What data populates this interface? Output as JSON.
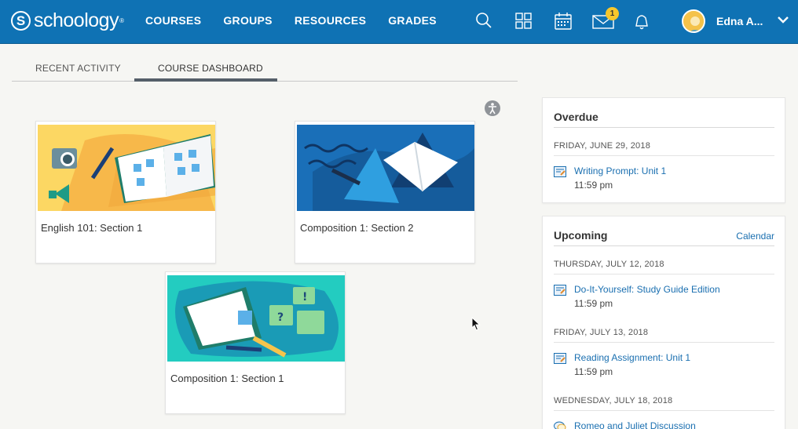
{
  "brand": {
    "name": "schoology",
    "mark": "S",
    "tm": "®"
  },
  "nav": {
    "items": [
      "COURSES",
      "GROUPS",
      "RESOURCES",
      "GRADES"
    ]
  },
  "nav_icons": {
    "search": "search-icon",
    "apps": "apps-grid-icon",
    "calendar": "calendar-icon",
    "messages": "envelope-icon",
    "notifications": "bell-icon",
    "message_count": "1"
  },
  "user": {
    "name": "Edna A..."
  },
  "tabs": {
    "recent": "RECENT ACTIVITY",
    "dashboard": "COURSE DASHBOARD",
    "active": "dashboard"
  },
  "courses": [
    {
      "title": "English 101: Section 1",
      "bg": "#fcd763"
    },
    {
      "title": "Composition 1: Section 2",
      "bg": "#1a6fb8"
    },
    {
      "title": "Composition 1: Section 1",
      "bg": "#23ccc0"
    }
  ],
  "overdue": {
    "title": "Overdue",
    "date": "FRIDAY, JUNE 29, 2018",
    "items": [
      {
        "title": "Writing Prompt: Unit 1",
        "time": "11:59 pm"
      }
    ]
  },
  "upcoming": {
    "title": "Upcoming",
    "calendar_link": "Calendar",
    "groups": [
      {
        "date": "THURSDAY, JULY 12, 2018",
        "title": "Do-It-Yourself: Study Guide Edition",
        "time": "11:59 pm",
        "icon": "assignment-icon"
      },
      {
        "date": "FRIDAY, JULY 13, 2018",
        "title": "Reading Assignment: Unit 1",
        "time": "11:59 pm",
        "icon": "assignment-icon"
      },
      {
        "date": "WEDNESDAY, JULY 18, 2018",
        "title": "Romeo and Juliet Discussion",
        "time": "",
        "icon": "discussion-icon"
      }
    ]
  },
  "colors": {
    "topbar": "#0f72b4",
    "link": "#1a6fb0",
    "badge": "#f6c72c"
  }
}
